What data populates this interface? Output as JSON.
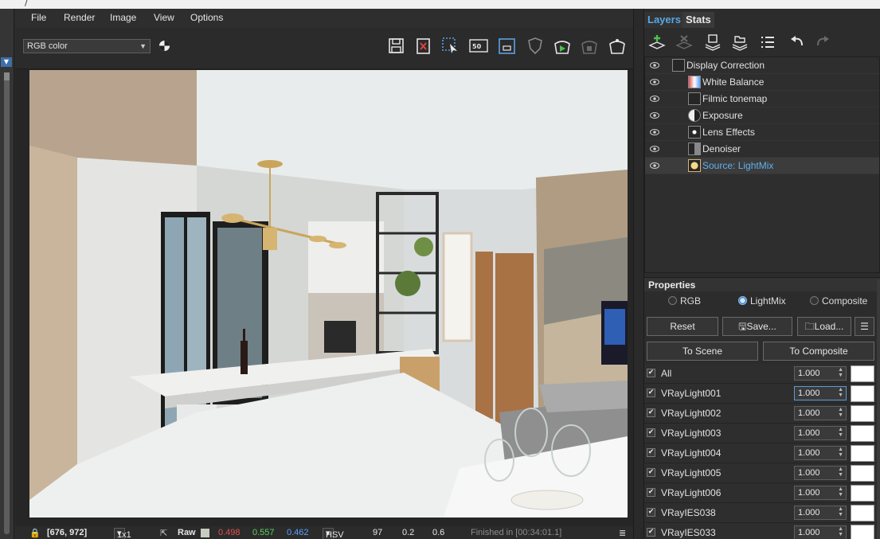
{
  "window": {
    "title_fragment": "/"
  },
  "menu": [
    "File",
    "Render",
    "Image",
    "View",
    "Options"
  ],
  "toolbar": {
    "channel_select": "RGB color",
    "icons": [
      "save-icon",
      "clear-image-icon",
      "region-render-icon",
      "zoom-50-icon",
      "follow-mouse-icon",
      "shield-icon",
      "start-interactive-icon",
      "teapot-disabled-icon",
      "render-teapot-icon"
    ],
    "zoom_label": "50"
  },
  "status": {
    "coords": "[676, 972]",
    "sample": "1x1",
    "raw_label": "Raw",
    "r": "0.498",
    "g": "0.557",
    "b": "0.462",
    "mode": "HSV",
    "h": "97",
    "s": "0.2",
    "v": "0.6",
    "message": "Finished in [00:34:01.1]",
    "colors": {
      "r": "#e05050",
      "g": "#5ad05a",
      "b": "#5aa0ff"
    }
  },
  "tabs": {
    "layers": "Layers",
    "stats": "Stats"
  },
  "layer_tools": [
    "create-layer-icon",
    "delete-layer-icon",
    "save-layers-icon",
    "load-layers-icon",
    "layer-list-icon",
    "undo-icon",
    "redo-icon"
  ],
  "layers": [
    {
      "name": "Display Correction",
      "icon": "display-correction-icon"
    },
    {
      "name": "White Balance",
      "icon": "white-balance-icon"
    },
    {
      "name": "Filmic tonemap",
      "icon": "filmic-tonemap-icon"
    },
    {
      "name": "Exposure",
      "icon": "exposure-icon"
    },
    {
      "name": "Lens Effects",
      "icon": "lens-effects-icon"
    },
    {
      "name": "Denoiser",
      "icon": "denoiser-icon"
    },
    {
      "name": "Source: LightMix",
      "icon": "lightmix-bulb-icon"
    }
  ],
  "properties": {
    "title": "Properties",
    "modes": [
      "RGB",
      "LightMix",
      "Composite"
    ],
    "selected_mode": "LightMix",
    "buttons": {
      "reset": "Reset",
      "save": "Save...",
      "load": "Load...",
      "to_scene": "To Scene",
      "to_composite": "To Composite"
    }
  },
  "lights": [
    {
      "name": "All",
      "value": "1.000"
    },
    {
      "name": "VRayLight001",
      "value": "1.000"
    },
    {
      "name": "VRayLight002",
      "value": "1.000"
    },
    {
      "name": "VRayLight003",
      "value": "1.000"
    },
    {
      "name": "VRayLight004",
      "value": "1.000"
    },
    {
      "name": "VRayLight005",
      "value": "1.000"
    },
    {
      "name": "VRayLight006",
      "value": "1.000"
    },
    {
      "name": "VRayIES038",
      "value": "1.000"
    },
    {
      "name": "VRayIES033",
      "value": "1.000"
    }
  ],
  "accent_color": "#56a8e6"
}
